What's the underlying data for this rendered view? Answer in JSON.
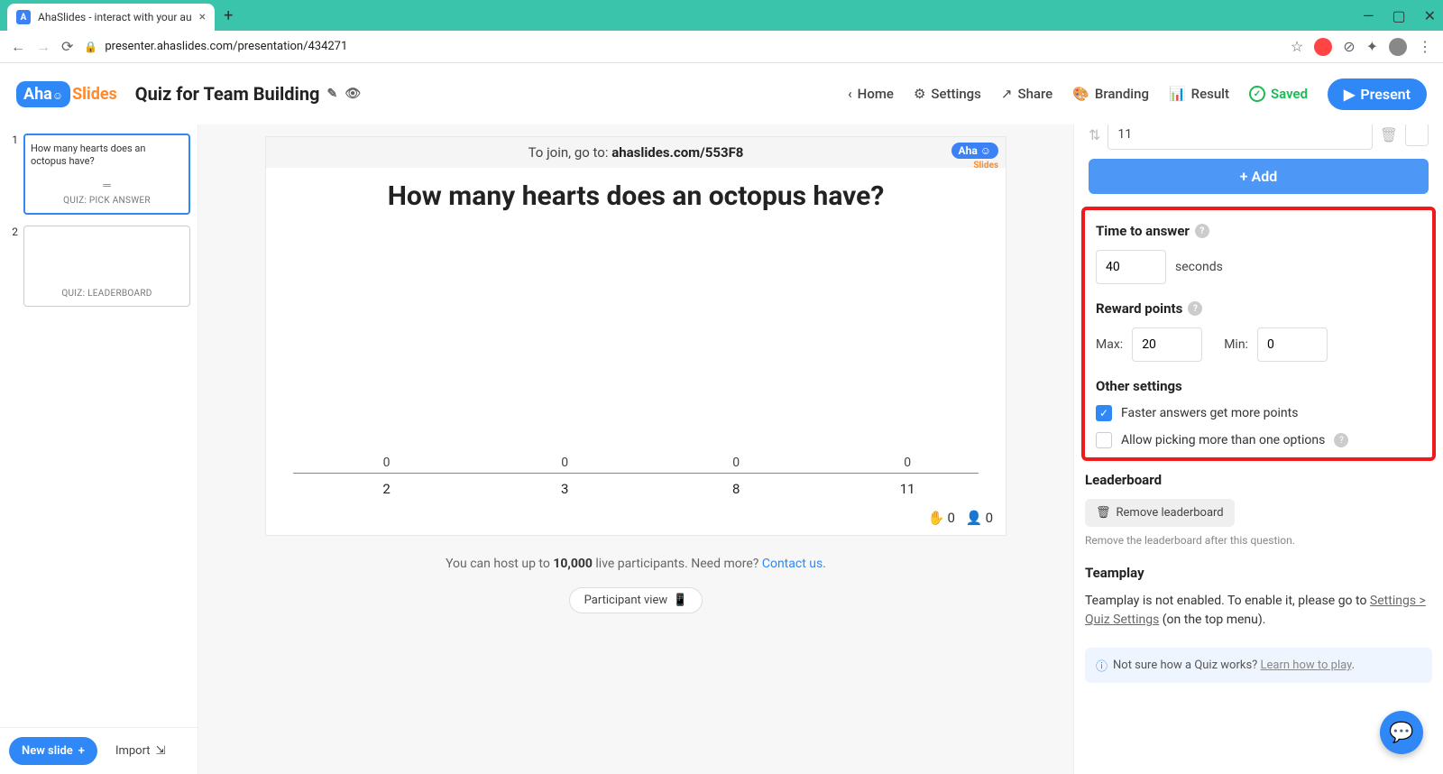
{
  "browser": {
    "tab_title": "AhaSlides - interact with your au",
    "url": "presenter.ahaslides.com/presentation/434271"
  },
  "header": {
    "logo_a": "Aha",
    "logo_b": "Slides",
    "title": "Quiz for Team Building",
    "home": "Home",
    "settings": "Settings",
    "share": "Share",
    "branding": "Branding",
    "result": "Result",
    "saved": "Saved",
    "present": "Present"
  },
  "sidebar": {
    "slides": [
      {
        "num": "1",
        "title": "How many hearts does an octopus have?",
        "type": "QUIZ: PICK ANSWER",
        "active": true
      },
      {
        "num": "2",
        "title": "",
        "type": "QUIZ: LEADERBOARD",
        "active": false
      }
    ],
    "new_slide": "New slide",
    "import": "Import"
  },
  "canvas": {
    "join_prefix": "To join, go to: ",
    "join_code": "ahaslides.com/553F8",
    "question": "How many hearts does an octopus have?",
    "hand_count": "0",
    "people_count": "0",
    "host_note_a": "You can host up to ",
    "host_note_b": "10,000",
    "host_note_c": " live participants. Need more? ",
    "contact": "Contact us",
    "participant_view": "Participant view"
  },
  "chart_data": {
    "type": "bar",
    "categories": [
      "2",
      "3",
      "8",
      "11"
    ],
    "values": [
      0,
      0,
      0,
      0
    ],
    "title": "",
    "xlabel": "",
    "ylabel": ""
  },
  "panel": {
    "option_value": "11",
    "add": "Add",
    "time_title": "Time to answer",
    "time_value": "40",
    "seconds": "seconds",
    "reward_title": "Reward points",
    "max_label": "Max:",
    "max_value": "20",
    "min_label": "Min:",
    "min_value": "0",
    "other_title": "Other settings",
    "faster": "Faster answers get more points",
    "allow_multi": "Allow picking more than one options",
    "leaderboard_title": "Leaderboard",
    "remove_lb": "Remove leaderboard",
    "remove_hint": "Remove the leaderboard after this question.",
    "teamplay_title": "Teamplay",
    "teamplay_text_a": "Teamplay is not enabled. To enable it, please go to ",
    "teamplay_link": "Settings > Quiz Settings",
    "teamplay_text_b": " (on the top menu).",
    "info_text": "Not sure how a Quiz works? ",
    "info_link": "Learn how to play"
  }
}
